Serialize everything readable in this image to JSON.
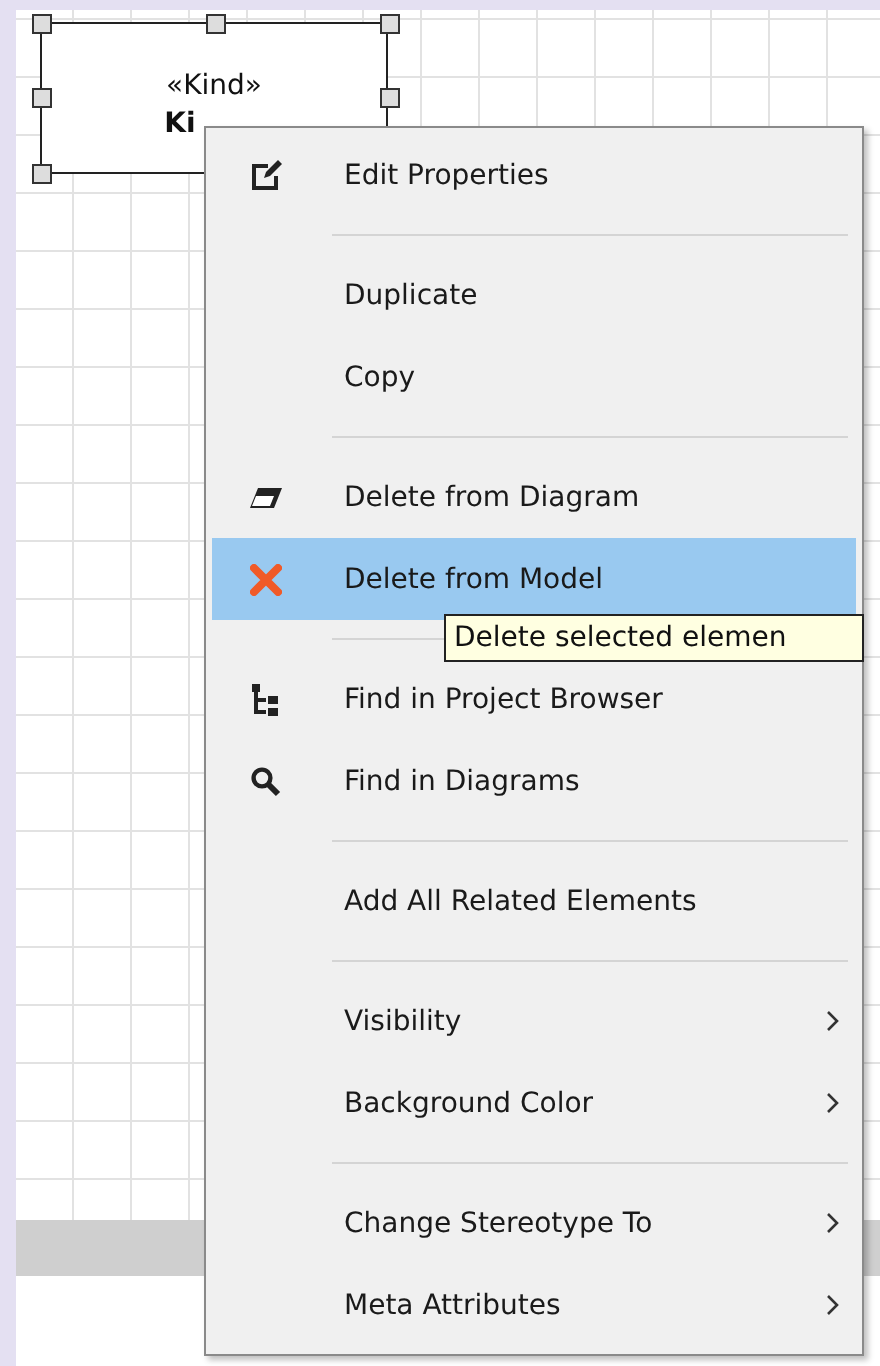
{
  "diagram": {
    "node": {
      "stereotype": "«Kind»",
      "name": "Ki",
      "selected": true
    }
  },
  "context_menu": {
    "items": [
      {
        "kind": "item",
        "label": "Edit Properties",
        "selected": false
      },
      {
        "kind": "separator"
      },
      {
        "kind": "item",
        "label": "Duplicate",
        "selected": false
      },
      {
        "kind": "item",
        "label": "Copy",
        "selected": false
      },
      {
        "kind": "separator"
      },
      {
        "kind": "item",
        "label": "Delete from Diagram",
        "selected": false
      },
      {
        "kind": "item",
        "label": "Delete from Model",
        "selected": true
      },
      {
        "kind": "separator"
      },
      {
        "kind": "item",
        "label": "Find in Project Browser",
        "selected": false
      },
      {
        "kind": "item",
        "label": "Find in Diagrams",
        "selected": false
      },
      {
        "kind": "separator"
      },
      {
        "kind": "item",
        "label": "Add All Related Elements",
        "selected": false
      },
      {
        "kind": "separator"
      },
      {
        "kind": "submenu",
        "label": "Visibility",
        "selected": false
      },
      {
        "kind": "submenu",
        "label": "Background Color",
        "selected": false
      },
      {
        "kind": "separator"
      },
      {
        "kind": "submenu",
        "label": "Change Stereotype To",
        "selected": false
      },
      {
        "kind": "submenu",
        "label": "Meta Attributes",
        "selected": false
      }
    ]
  },
  "tooltip": {
    "text": "Delete selected elemen"
  }
}
